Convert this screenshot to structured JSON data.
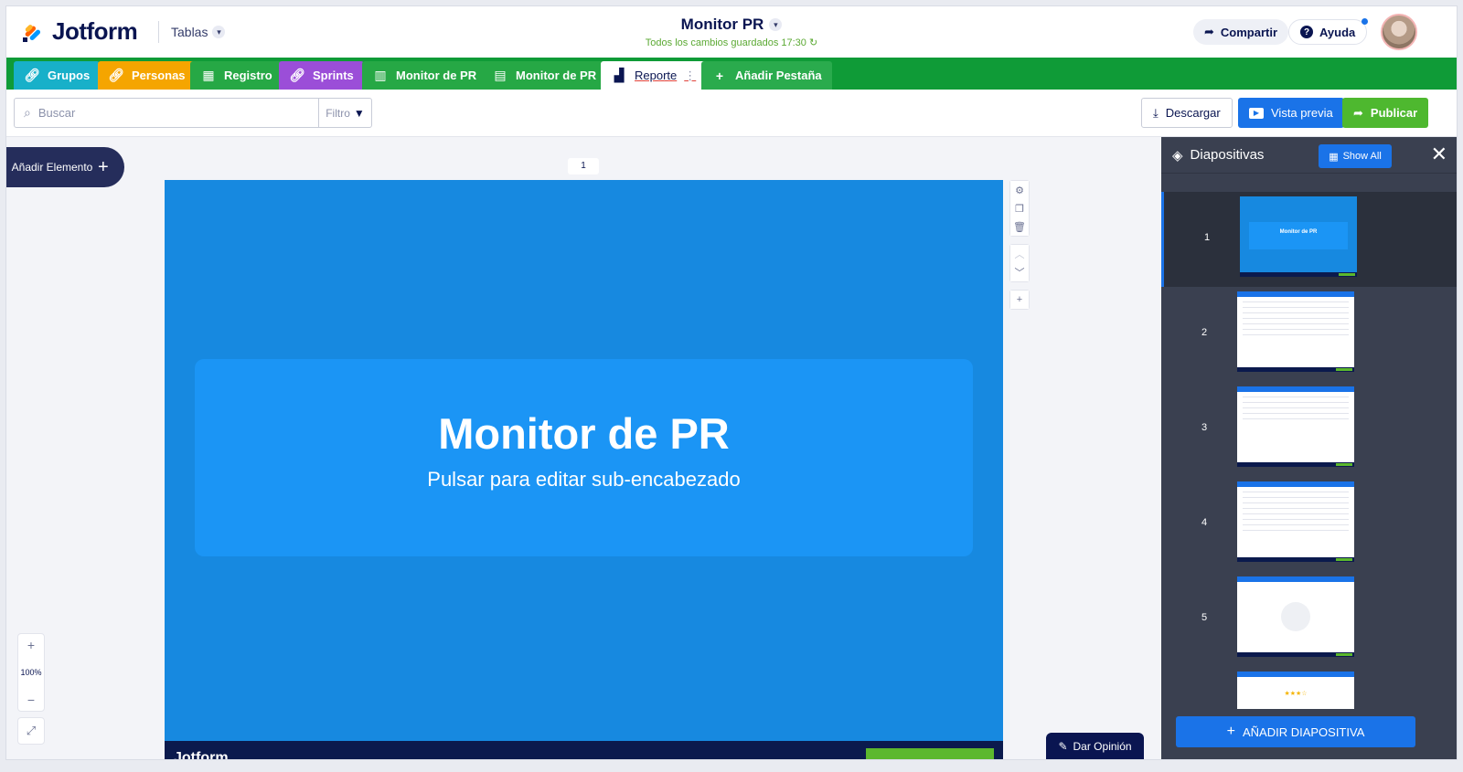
{
  "header": {
    "logo_text": "Jotform",
    "tablas_label": "Tablas",
    "title": "Monitor PR",
    "saved_status": "Todos los cambios guardados 17:30",
    "share_label": "Compartir",
    "help_label": "Ayuda"
  },
  "tabs": [
    {
      "label": "Grupos",
      "color": "#18b0c9",
      "icon": "link-icon"
    },
    {
      "label": "Personas",
      "color": "#f5a500",
      "icon": "link-icon"
    },
    {
      "label": "Registro",
      "color": "#26a845",
      "icon": "table-icon"
    },
    {
      "label": "Sprints",
      "color": "#9b4ed8",
      "icon": "link-icon"
    },
    {
      "label": "Monitor de PR",
      "color": "#26a845",
      "icon": "board-icon"
    },
    {
      "label": "Monitor de PR",
      "color": "#26a845",
      "icon": "calendar-icon"
    },
    {
      "label": "Reporte",
      "active": true,
      "icon": "report-icon"
    },
    {
      "label": "Añadir Pestaña",
      "icon": "plus-icon"
    }
  ],
  "toolbar": {
    "search_placeholder": "Buscar",
    "filter_label": "Filtro",
    "download_label": "Descargar",
    "preview_label": "Vista previa",
    "publish_label": "Publicar"
  },
  "canvas": {
    "add_element_label": "Añadir Elemento",
    "slide_number": "1",
    "slide_title": "Monitor de PR",
    "slide_subtitle": "Pulsar para editar sub-encabezado",
    "zoom_level": "100%",
    "feedback_label": "Dar Opinión"
  },
  "panel": {
    "title": "Diapositivas",
    "show_all_label": "Show All",
    "thumbnails": [
      "1",
      "2",
      "3",
      "4",
      "5"
    ],
    "thumb1_title": "Monitor de PR",
    "add_slide_label": "AÑADIR DIAPOSITIVA"
  },
  "colors": {
    "brand_green": "#0f9b37",
    "slide_blue": "#1789e0",
    "accent_blue": "#1a73e8",
    "publish_green": "#4eb82f"
  }
}
